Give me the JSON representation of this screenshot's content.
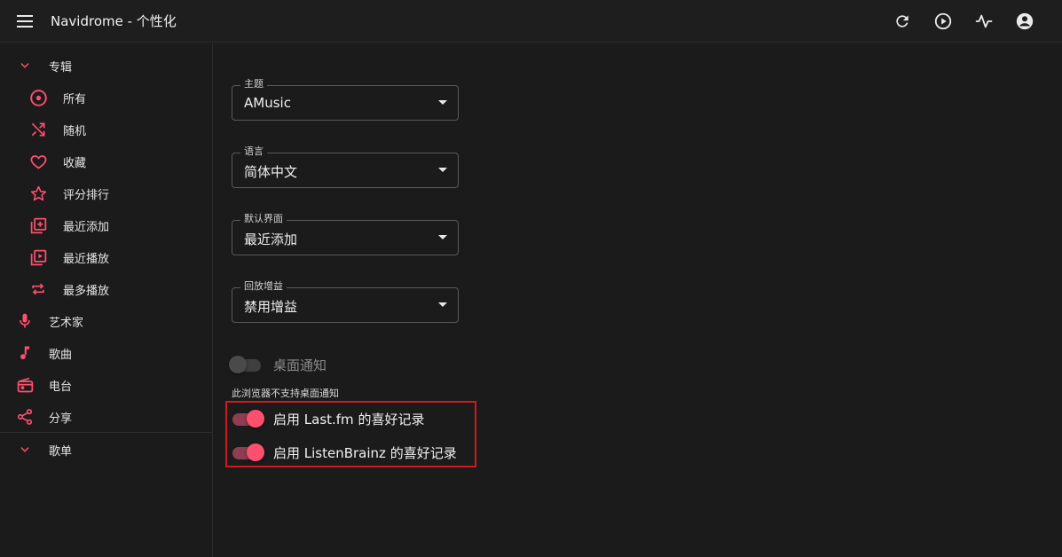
{
  "app": {
    "title": "Navidrome - 个性化",
    "accent_color": "#ff4f6f",
    "toolbar_icons": [
      "refresh-icon",
      "play-circle-icon",
      "activity-icon",
      "account-circle-icon"
    ]
  },
  "sidebar": {
    "albums_group": "专辑",
    "album_items": [
      {
        "label": "所有",
        "icon": "album-disc-icon"
      },
      {
        "label": "随机",
        "icon": "shuffle-icon"
      },
      {
        "label": "收藏",
        "icon": "heart-icon"
      },
      {
        "label": "评分排行",
        "icon": "star-icon"
      },
      {
        "label": "最近添加",
        "icon": "library-add-icon"
      },
      {
        "label": "最近播放",
        "icon": "video-library-icon"
      },
      {
        "label": "最多播放",
        "icon": "repeat-icon"
      }
    ],
    "items": [
      {
        "label": "艺术家",
        "icon": "microphone-icon"
      },
      {
        "label": "歌曲",
        "icon": "music-note-icon"
      },
      {
        "label": "电台",
        "icon": "radio-icon"
      },
      {
        "label": "分享",
        "icon": "share-icon"
      }
    ],
    "playlists_group": "歌单"
  },
  "settings": {
    "theme": {
      "label": "主题",
      "value": "AMusic"
    },
    "language": {
      "label": "语言",
      "value": "简体中文"
    },
    "default_view": {
      "label": "默认界面",
      "value": "最近添加"
    },
    "replay_gain": {
      "label": "回放增益",
      "value": "禁用增益"
    },
    "desktop_notifications": {
      "label": "桌面通知",
      "enabled": false,
      "helper": "此浏览器不支持桌面通知"
    },
    "lastfm_scrobble": {
      "label": "启用 Last.fm 的喜好记录",
      "enabled": true
    },
    "listenbrainz_scrobble": {
      "label": "启用 ListenBrainz 的喜好记录",
      "enabled": true
    }
  }
}
